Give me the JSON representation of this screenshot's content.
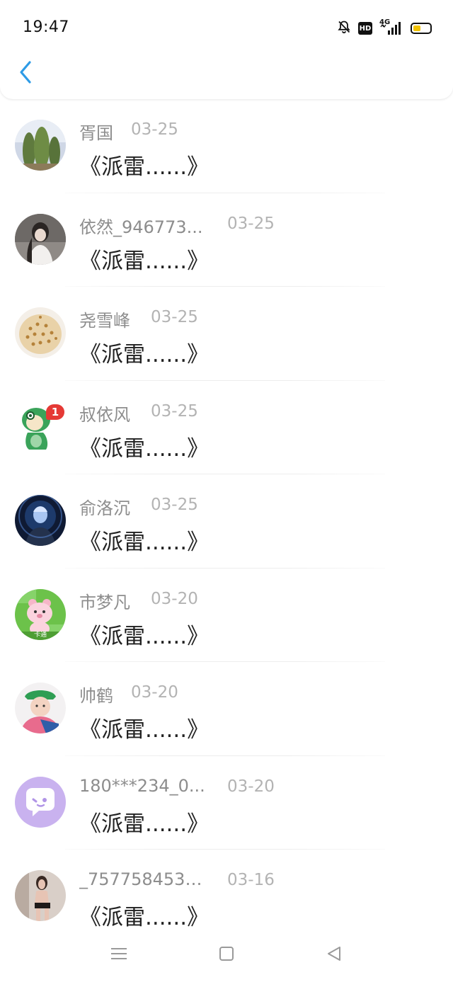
{
  "status_bar": {
    "time": "19:47",
    "network": "4G",
    "hd_label": "HD",
    "icons": [
      "bell-muted-icon",
      "hd-icon",
      "signal-icon",
      "battery-icon"
    ],
    "battery_color": "#f2c200"
  },
  "header": {
    "back_icon": "chevron-left-icon",
    "accent": "#2e9be6"
  },
  "messages": [
    {
      "name": "胥国",
      "date": "03-25",
      "text": "《派雷......》",
      "avatar": "cactus"
    },
    {
      "name": "依然_946773...",
      "date": "03-25",
      "text": "《派雷......》",
      "avatar": "girl-photo"
    },
    {
      "name": "尧雪峰",
      "date": "03-25",
      "text": "《派雷......》",
      "avatar": "shell"
    },
    {
      "name": "叔依风",
      "date": "03-25",
      "text": "《派雷......》",
      "avatar": "green-dino"
    },
    {
      "name": "俞洛沉",
      "date": "03-25",
      "text": "《派雷......》",
      "avatar": "dark-hero"
    },
    {
      "name": "市梦凡",
      "date": "03-20",
      "text": "《派雷......》",
      "avatar": "pink-bear"
    },
    {
      "name": "帅鹤",
      "date": "03-20",
      "text": "《派雷......》",
      "avatar": "boy-cap"
    },
    {
      "name": "180***234_0...",
      "date": "03-20",
      "text": "《派雷......》",
      "avatar": "chat-bubble"
    },
    {
      "name": "_7577584535...",
      "date": "03-16",
      "text": "《派雷......》",
      "avatar": "woman-photo"
    }
  ],
  "bear_avatar_label": "卡通",
  "dino_badge": "1",
  "nav": {
    "icons": [
      "menu-icon",
      "home-square-icon",
      "back-triangle-icon"
    ]
  }
}
